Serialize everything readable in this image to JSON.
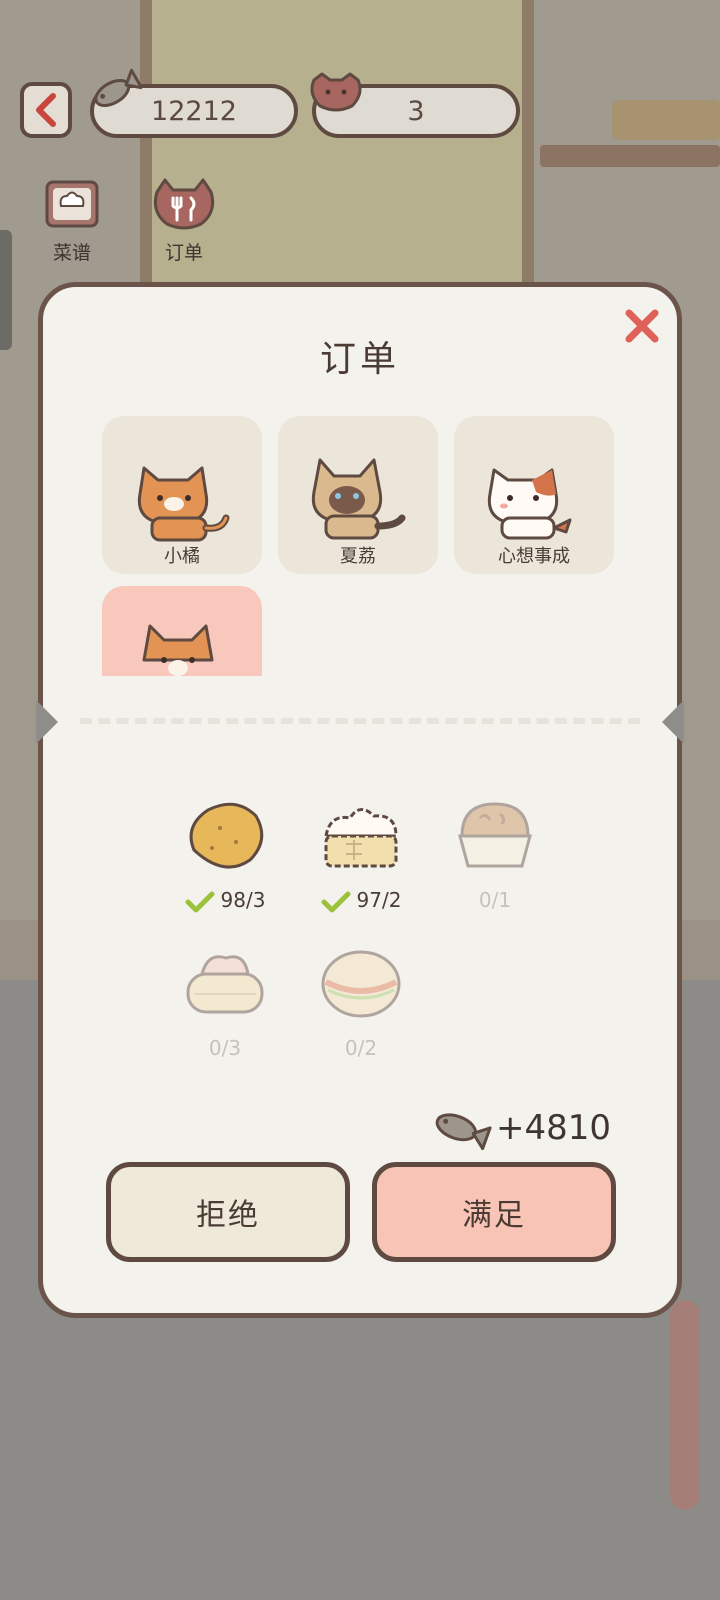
{
  "hud": {
    "fish_count": "12212",
    "heart_count": "3",
    "tools": [
      {
        "label": "菜谱",
        "icon": "recipe-book-icon"
      },
      {
        "label": "订单",
        "icon": "order-cat-icon"
      }
    ]
  },
  "dialog": {
    "title": "订单",
    "customers": [
      {
        "name": "小橘",
        "icon": "orange-tabby-cat"
      },
      {
        "name": "夏荔",
        "icon": "siamese-cat"
      },
      {
        "name": "心想事成",
        "icon": "calico-cat"
      },
      {
        "name": "",
        "icon": "orange-tabby-cat",
        "selected": true
      }
    ],
    "items": [
      {
        "icon": "potato-icon",
        "count": "98/3",
        "done": true
      },
      {
        "icon": "steamed-bun-icon",
        "count": "97/2",
        "done": true
      },
      {
        "icon": "cupcake-icon",
        "count": "0/1",
        "done": false
      },
      {
        "icon": "dumpling-basket-icon",
        "count": "0/3",
        "done": false
      },
      {
        "icon": "sandwich-bun-icon",
        "count": "0/2",
        "done": false
      }
    ],
    "reward": "+4810",
    "reject_label": "拒绝",
    "accept_label": "满足"
  },
  "colors": {
    "accent_pink": "#f8c4b5",
    "outline_brown": "#5e4a40",
    "close_red": "#e0605a",
    "check_green": "#9cc23c"
  }
}
